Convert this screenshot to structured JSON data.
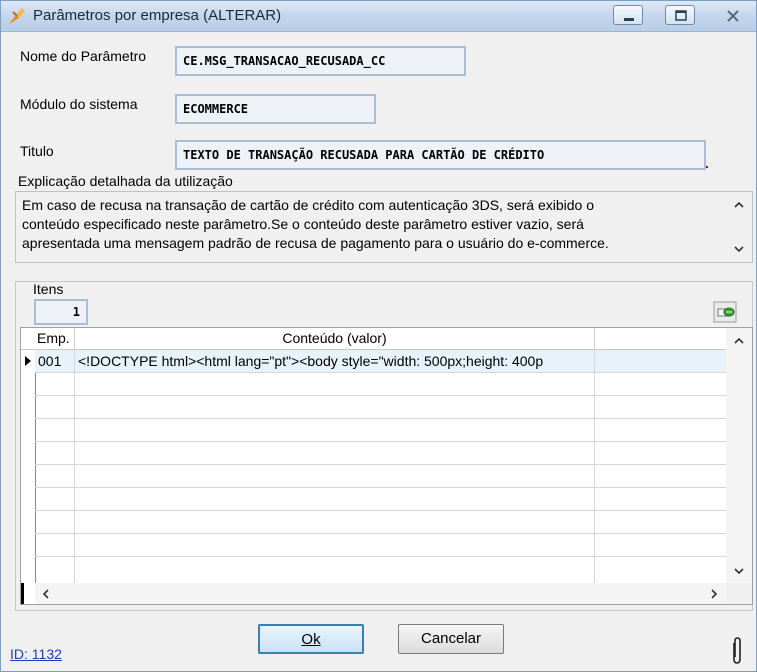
{
  "window": {
    "title": "Parâmetros por empresa (ALTERAR)"
  },
  "form": {
    "nome_label": "Nome do Parâmetro",
    "nome_value": "CE.MSG_TRANSACAO_RECUSADA_CC",
    "modulo_label": "Módulo do sistema",
    "modulo_value": "ECOMMERCE",
    "titulo_label": "Titulo",
    "titulo_value": "TEXTO DE TRANSAÇÃO RECUSADA PARA CARTÃO DE CRÉDITO",
    "explicacao_label": "Explicação detalhada da utilização",
    "explicacao_lines": [
      "Em caso de recusa na transação de cartão de crédito com autenticação 3DS, será exibido o",
      "conteúdo especificado neste parâmetro.Se o conteúdo deste parâmetro estiver vazio, será",
      "apresentada uma mensagem padrão de recusa de pagamento para o usuário do e-commerce."
    ]
  },
  "itens": {
    "label": "Itens",
    "count": "1"
  },
  "grid": {
    "columns": [
      "Emp.",
      "Conteúdo (valor)"
    ],
    "rows": [
      {
        "emp": "001",
        "conteudo": "<!DOCTYPE html><html lang=\"pt\"><body style=\"width: 500px;height: 400p"
      }
    ]
  },
  "buttons": {
    "ok": "Ok",
    "cancel": "Cancelar"
  },
  "footer": {
    "id_link": "ID: 1132"
  }
}
